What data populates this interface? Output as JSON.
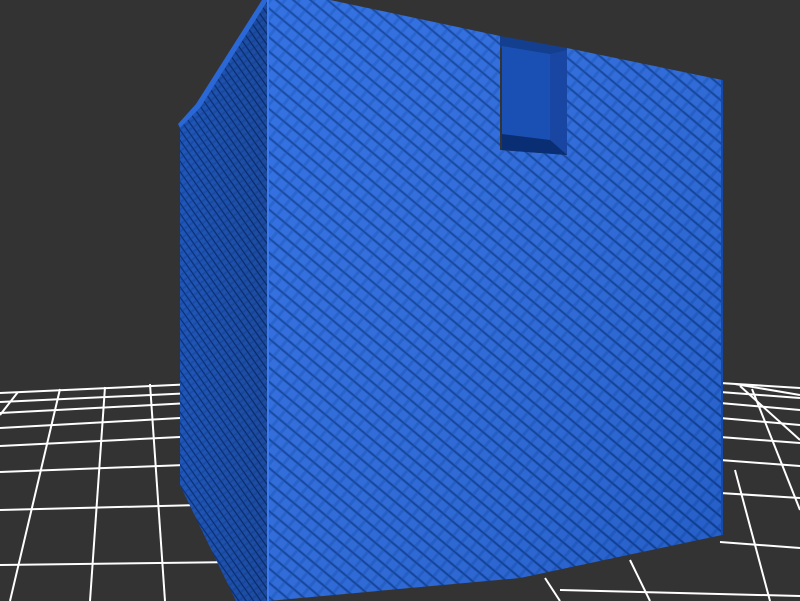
{
  "viewer": {
    "background_color": "#333333",
    "grid_color": "#ffffff",
    "model_color": "#1f5fd0",
    "model_shape": "box",
    "surface_texture": "diamond-lattice"
  }
}
